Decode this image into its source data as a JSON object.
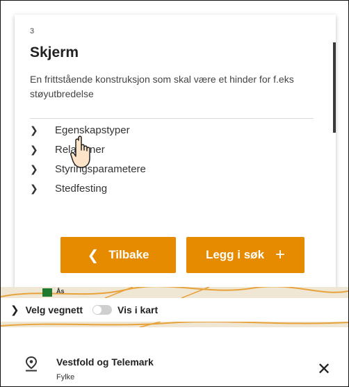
{
  "object": {
    "number": "3",
    "title": "Skjerm",
    "description": "En frittstående konstruksjon som skal være et hinder for f.eks støyutbredelse"
  },
  "sections": [
    {
      "label": "Egenskapstyper",
      "icon": "chevron-right-icon"
    },
    {
      "label": "Relasjoner",
      "icon": "chevron-right-icon"
    },
    {
      "label": "Styringsparametere",
      "icon": "chevron-right-icon"
    },
    {
      "label": "Stedfesting",
      "icon": "chevron-right-icon"
    }
  ],
  "buttons": {
    "back_label": "Tilbake",
    "add_label": "Legg i søk"
  },
  "road_network": {
    "label": "Velg vegnett",
    "toggle_label": "Vis i kart",
    "toggle_on": false
  },
  "area": {
    "name": "Vestfold og Telemark",
    "type": "Fylke"
  },
  "map": {
    "label_partial": "Ås"
  },
  "colors": {
    "accent": "#e68a00",
    "map_bg": "#efe6d4",
    "toggle_off": "#cfcfcf"
  }
}
